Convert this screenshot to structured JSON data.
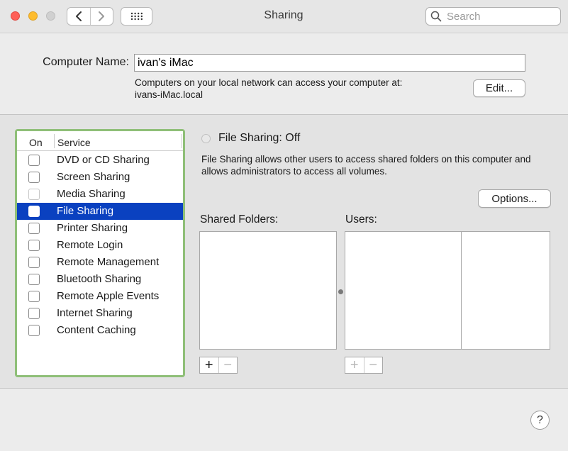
{
  "window": {
    "title": "Sharing"
  },
  "search": {
    "placeholder": "Search"
  },
  "computer_name": {
    "label": "Computer Name:",
    "value": "ivan's iMac",
    "description_line1": "Computers on your local network can access your computer at:",
    "description_line2": "ivans-iMac.local",
    "edit_label": "Edit..."
  },
  "services": {
    "header_on": "On",
    "header_service": "Service",
    "items": [
      {
        "label": "DVD or CD Sharing",
        "checked": false
      },
      {
        "label": "Screen Sharing",
        "checked": false
      },
      {
        "label": "Media Sharing",
        "checked": false
      },
      {
        "label": "File Sharing",
        "checked": false,
        "selected": true
      },
      {
        "label": "Printer Sharing",
        "checked": false
      },
      {
        "label": "Remote Login",
        "checked": false
      },
      {
        "label": "Remote Management",
        "checked": false
      },
      {
        "label": "Bluetooth Sharing",
        "checked": false
      },
      {
        "label": "Remote Apple Events",
        "checked": false
      },
      {
        "label": "Internet Sharing",
        "checked": false
      },
      {
        "label": "Content Caching",
        "checked": false
      }
    ]
  },
  "detail": {
    "status": "File Sharing: Off",
    "description": "File Sharing allows other users to access shared folders on this computer and allows administrators to access all volumes.",
    "options_label": "Options...",
    "shared_folders_label": "Shared Folders:",
    "users_label": "Users:",
    "add_symbol": "+",
    "remove_symbol": "−"
  },
  "help": {
    "symbol": "?"
  },
  "colors": {
    "selection": "#0a41c0",
    "focus_ring": "#8fbf78"
  }
}
